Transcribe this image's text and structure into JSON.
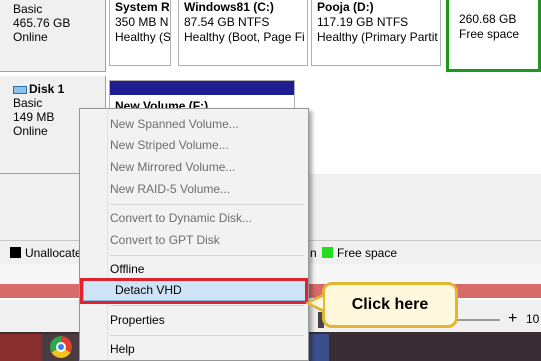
{
  "disk0": {
    "type": "Basic",
    "size": "465.76 GB",
    "status": "Online",
    "partitions": [
      {
        "name": "System R",
        "size": "350 MB N",
        "status": "Healthy (S"
      },
      {
        "name": "Windows81  (C:)",
        "size": "87.54 GB NTFS",
        "status": "Healthy (Boot, Page Fi"
      },
      {
        "name": "Pooja  (D:)",
        "size": "117.19 GB NTFS",
        "status": "Healthy (Primary Partit"
      }
    ],
    "free": {
      "size": "260.68 GB",
      "label": "Free space"
    }
  },
  "disk1": {
    "name": "Disk 1",
    "type": "Basic",
    "size": "149 MB",
    "status": "Online",
    "volume": {
      "name": "New Volume  (F:)"
    }
  },
  "legend": {
    "unallocated": "Unallocate",
    "free_space": "Free space",
    "n_fragment": "n",
    "colors": {
      "unallocated": "#000000",
      "free_space": "#22dd22"
    }
  },
  "context_menu": {
    "items": [
      {
        "label": "New Spanned Volume...",
        "enabled": false
      },
      {
        "label": "New Striped Volume...",
        "enabled": false
      },
      {
        "label": "New Mirrored Volume...",
        "enabled": false
      },
      {
        "label": "New RAID-5 Volume...",
        "enabled": false
      },
      {
        "label": "Convert to Dynamic Disk...",
        "enabled": false
      },
      {
        "label": "Convert to GPT Disk",
        "enabled": false
      },
      {
        "label": "Offline",
        "enabled": true
      },
      {
        "label": "Detach VHD",
        "enabled": true,
        "highlighted": true
      },
      {
        "label": "Properties",
        "enabled": true
      },
      {
        "label": "Help",
        "enabled": true
      }
    ]
  },
  "annotation": {
    "callout_text": "Click here",
    "box_color": "#e0212e",
    "callout_border": "#e2b533"
  },
  "zoom": {
    "plus": "+",
    "value": "10"
  }
}
